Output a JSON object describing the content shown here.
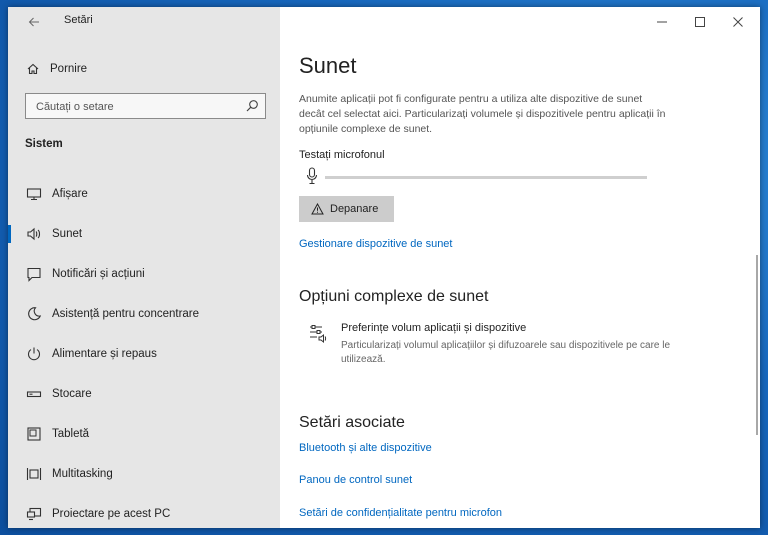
{
  "window": {
    "title": "Setări",
    "controls": {
      "minimize": "—",
      "maximize": "☐",
      "close": "✕"
    }
  },
  "sidebar": {
    "home_label": "Pornire",
    "search_placeholder": "Căutați o setare",
    "section_label": "Sistem",
    "items": [
      {
        "label": "Afișare",
        "icon": "monitor-icon"
      },
      {
        "label": "Sunet",
        "icon": "speaker-icon",
        "active": true
      },
      {
        "label": "Notificări și acțiuni",
        "icon": "notification-icon"
      },
      {
        "label": "Asistență pentru concentrare",
        "icon": "moon-icon"
      },
      {
        "label": "Alimentare și repaus",
        "icon": "power-icon"
      },
      {
        "label": "Stocare",
        "icon": "storage-icon"
      },
      {
        "label": "Tabletă",
        "icon": "tablet-icon"
      },
      {
        "label": "Multitasking",
        "icon": "multitasking-icon"
      },
      {
        "label": "Proiectare pe acest PC",
        "icon": "projecting-icon"
      }
    ]
  },
  "main": {
    "title": "Sunet",
    "description": "Anumite aplicații pot fi configurate pentru a utiliza alte dispozitive de sunet decât cel selectat aici. Particularizați volumele și dispozitivele pentru aplicații în opțiunile complexe de sunet.",
    "mic_test_label": "Testați microfonul",
    "troubleshoot_label": "Depanare",
    "manage_devices_link": "Gestionare dispozitive de sunet",
    "advanced_heading": "Opțiuni complexe de sunet",
    "pref_title": "Preferințe volum aplicații și dispozitive",
    "pref_desc": "Particularizați volumul aplicațiilor și difuzoarele sau dispozitivele pe care le utilizează.",
    "related_heading": "Setări asociate",
    "related_links": [
      "Bluetooth și alte dispozitive",
      "Panou de control sunet",
      "Setări de confidențialitate pentru microfon"
    ]
  }
}
